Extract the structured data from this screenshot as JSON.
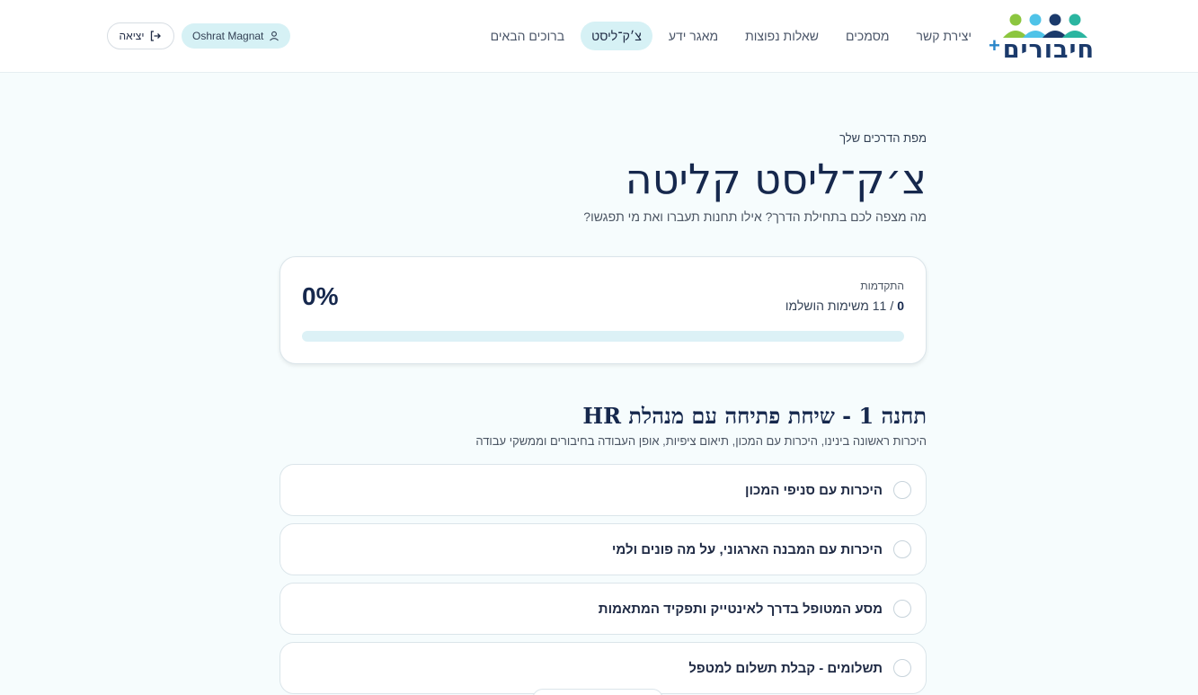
{
  "header": {
    "logo_text": "חיבורים",
    "logo_plus": "+",
    "nav": [
      {
        "label": "ברוכים הבאים",
        "active": false
      },
      {
        "label": "צ׳ק־ליסט",
        "active": true
      },
      {
        "label": "מאגר ידע",
        "active": false
      },
      {
        "label": "שאלות נפוצות",
        "active": false
      },
      {
        "label": "מסמכים",
        "active": false
      },
      {
        "label": "יצירת קשר",
        "active": false
      }
    ],
    "user_name": "Oshrat Magnat",
    "logout_label": "יציאה"
  },
  "page": {
    "eyebrow": "מפת הדרכים שלך",
    "title": "צ׳ק־ליסט קליטה",
    "subtitle": "מה מצפה לכם בתחילת הדרך? אילו תחנות תעברו ואת מי תפגשו?"
  },
  "progress": {
    "label": "התקדמות",
    "completed": "0",
    "separator": "/",
    "total_text": "11 משימות הושלמו",
    "percent_text": "0%",
    "fraction": 0
  },
  "station": {
    "title": "תחנה 1 - שיחת פתיחה עם מנהלת HR",
    "description": "היכרות ראשונה בינינו, היכרות עם המכון, תיאום ציפיות, אופן העבודה בחיבורים וממשקי עבודה",
    "tasks": [
      {
        "label": "היכרות עם סניפי המכון"
      },
      {
        "label": "היכרות עם המבנה הארגוני, על מה פונים ולמי"
      },
      {
        "label": "מסע המטופל בדרך לאינטייק ותפקיד המתאמות"
      },
      {
        "label": "תשלומים - קבלת תשלום למטפל"
      }
    ]
  },
  "colors": {
    "accent": "#d6f1f5",
    "brand_dark": "#16284d",
    "brand_blue": "#2a86c9"
  }
}
